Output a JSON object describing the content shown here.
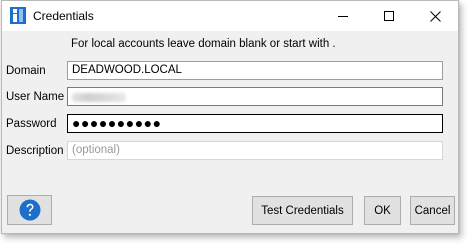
{
  "window": {
    "title": "Credentials",
    "controls": {
      "minimize_icon": "minimize-icon",
      "maximize_icon": "maximize-icon",
      "close_icon": "close-icon"
    }
  },
  "hint": "For local accounts leave domain blank or start with .",
  "form": {
    "domain": {
      "label": "Domain",
      "value": "DEADWOOD.LOCAL"
    },
    "username": {
      "label": "User Name",
      "value": ""
    },
    "password": {
      "label": "Password",
      "value": "●●●●●●●●●●"
    },
    "description": {
      "label": "Description",
      "value": "",
      "placeholder": "(optional)"
    }
  },
  "buttons": {
    "help_icon": "help-question-icon",
    "test": "Test Credentials",
    "ok": "OK",
    "cancel": "Cancel"
  },
  "colors": {
    "accent": "#1e6fc9",
    "window_bg": "#f0f0f0",
    "button_bg": "#e1e1e1"
  }
}
